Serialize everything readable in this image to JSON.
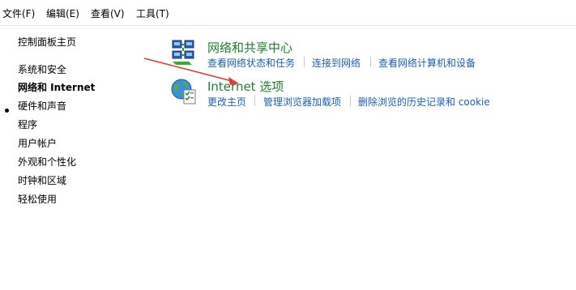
{
  "menubar": {
    "items": [
      {
        "label": "文件(F)"
      },
      {
        "label": "编辑(E)"
      },
      {
        "label": "查看(V)"
      },
      {
        "label": "工具(T)"
      }
    ]
  },
  "sidebar": {
    "home": "控制面板主页",
    "items": [
      {
        "label": "系统和安全"
      },
      {
        "label": "网络和 Internet"
      },
      {
        "label": "硬件和声音"
      },
      {
        "label": "程序"
      },
      {
        "label": "用户帐户"
      },
      {
        "label": "外观和个性化"
      },
      {
        "label": "时钟和区域"
      },
      {
        "label": "轻松使用"
      }
    ],
    "active_index": 1
  },
  "categories": [
    {
      "title": "网络和共享中心",
      "icon": "network-center-icon",
      "links": [
        "查看网络状态和任务",
        "连接到网络",
        "查看网络计算机和设备"
      ]
    },
    {
      "title": "Internet 选项",
      "icon": "internet-options-icon",
      "links": [
        "更改主页",
        "管理浏览器加载项",
        "删除浏览的历史记录和 cookie"
      ]
    }
  ],
  "annotation": {
    "color": "#e53935"
  },
  "colors": {
    "title_green": "#1e7f2e",
    "link_blue": "#1a5fb4"
  }
}
